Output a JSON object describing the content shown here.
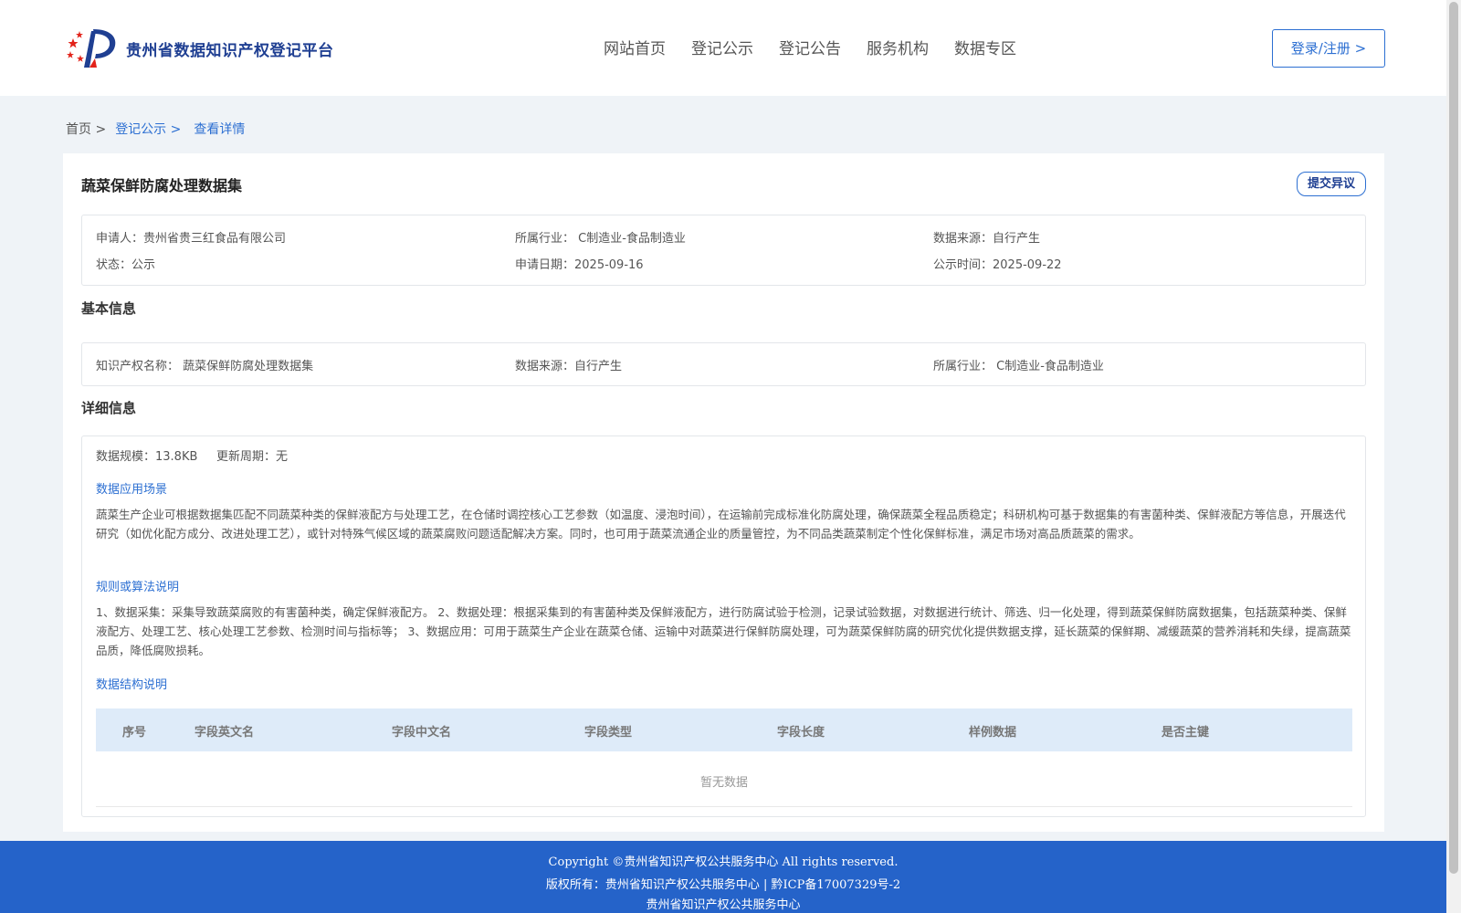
{
  "header": {
    "site_name": "贵州省数据知识产权登记平台",
    "nav": [
      "网站首页",
      "登记公示",
      "登记公告",
      "服务机构",
      "数据专区"
    ],
    "login": "登录/注册 >"
  },
  "breadcrumb": {
    "home": "首页 >",
    "section": "登记公示 >",
    "current": "查看详情"
  },
  "detail": {
    "title": "蔬菜保鲜防腐处理数据集",
    "objection_button": "提交异议",
    "summary": {
      "applicant": "申请人：贵州省贵三红食品有限公司",
      "industry": "所属行业： C制造业-食品制造业",
      "source": "数据来源：自行产生",
      "status": "状态：公示",
      "apply_date": "申请日期：2025-09-16",
      "publish_date": "公示时间：2025-09-22"
    },
    "basic_title": "基本信息",
    "basic": {
      "ip_name": "知识产权名称： 蔬菜保鲜防腐处理数据集",
      "source": "数据来源：自行产生",
      "industry": "所属行业： C制造业-食品制造业"
    },
    "detail_title": "详细信息",
    "scale": "数据规模：13.8KB",
    "update_cycle": "更新周期：无",
    "scenario_title": "数据应用场景",
    "scenario_text": "蔬菜生产企业可根据数据集匹配不同蔬菜种类的保鲜液配方与处理工艺，在仓储时调控核心工艺参数（如温度、浸泡时间），在运输前完成标准化防腐处理，确保蔬菜全程品质稳定；科研机构可基于数据集的有害菌种类、保鲜液配方等信息，开展迭代研究（如优化配方成分、改进处理工艺），或针对特殊气候区域的蔬菜腐败问题适配解决方案。同时，也可用于蔬菜流通企业的质量管控，为不同品类蔬菜制定个性化保鲜标准，满足市场对高品质蔬菜的需求。",
    "rules_title": "规则或算法说明",
    "rules_text": "1、数据采集：采集导致蔬菜腐败的有害菌种类，确定保鲜液配方。 2、数据处理：根据采集到的有害菌种类及保鲜液配方，进行防腐试验于检测，记录试验数据，对数据进行统计、筛选、归一化处理，得到蔬菜保鲜防腐数据集，包括蔬菜种类、保鲜液配方、处理工艺、核心处理工艺参数、检测时间与指标等； 3、数据应用：可用于蔬菜生产企业在蔬菜仓储、运输中对蔬菜进行保鲜防腐处理，可为蔬菜保鲜防腐的研究优化提供数据支撑，延长蔬菜的保鲜期、减缓蔬菜的营养消耗和失绿，提高蔬菜品质，降低腐败损耗。",
    "structure_title": "数据结构说明",
    "table_headers": [
      "序号",
      "字段英文名",
      "字段中文名",
      "字段类型",
      "字段长度",
      "样例数据",
      "是否主键"
    ],
    "table_empty": "暂无数据"
  },
  "footer": {
    "line1": "Copyright ©贵州省知识产权公共服务中心 All rights reserved.",
    "line2": "版权所有：贵州省知识产权公共服务中心 | 黔ICP备17007329号-2",
    "line3": "贵州省知识产权公共服务中心"
  },
  "colors": {
    "accent": "#2c6fd2",
    "brand": "#1f3f92",
    "footer_bg": "#2563c9",
    "table_head_bg": "#deebf9"
  }
}
